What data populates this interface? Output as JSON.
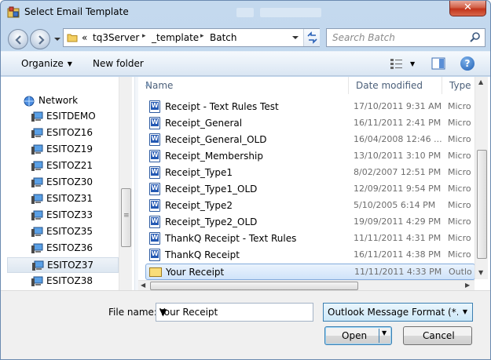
{
  "window": {
    "title": "Select Email Template",
    "close_glyph": "✕"
  },
  "nav": {
    "back_icon": "back-arrow-icon",
    "forward_icon": "forward-arrow-icon"
  },
  "address": {
    "overflow": "«",
    "crumbs": [
      "tq3Server",
      "_template",
      "Batch"
    ],
    "separator": "▸"
  },
  "search": {
    "placeholder": "Search Batch"
  },
  "toolbar": {
    "organize_label": "Organize",
    "new_folder_label": "New folder",
    "help_glyph": "?"
  },
  "navpane": {
    "network_label": "Network",
    "items": [
      "ESITDEMO",
      "ESITOZ16",
      "ESITOZ19",
      "ESITOZ21",
      "ESITOZ30",
      "ESITOZ31",
      "ESITOZ33",
      "ESITOZ35",
      "ESITOZ36",
      "ESITOZ37",
      "ESITOZ38"
    ],
    "selected": "ESITOZ37"
  },
  "filelist": {
    "columns": {
      "name": "Name",
      "date": "Date modified",
      "type": "Type"
    },
    "rows": [
      {
        "name": "Receipt - Text Rules Test",
        "date": "17/10/2011 9:31 AM",
        "type": "Micro",
        "icon": "word-doc-icon"
      },
      {
        "name": "Receipt_General",
        "date": "16/11/2011 2:41 PM",
        "type": "Micro",
        "icon": "word-doc-icon"
      },
      {
        "name": "Receipt_General_OLD",
        "date": "16/04/2008 12:46 ...",
        "type": "Micro",
        "icon": "word-doc-icon"
      },
      {
        "name": "Receipt_Membership",
        "date": "13/10/2011 3:10 PM",
        "type": "Micro",
        "icon": "word-doc-icon"
      },
      {
        "name": "Receipt_Type1",
        "date": "8/02/2007 12:51 PM",
        "type": "Micro",
        "icon": "word-doc-icon"
      },
      {
        "name": "Receipt_Type1_OLD",
        "date": "12/09/2011 9:54 PM",
        "type": "Micro",
        "icon": "word-doc-icon"
      },
      {
        "name": "Receipt_Type2",
        "date": "5/10/2005 6:14 PM",
        "type": "Micro",
        "icon": "word-doc-icon"
      },
      {
        "name": "Receipt_Type2_OLD",
        "date": "19/09/2011 4:29 PM",
        "type": "Micro",
        "icon": "word-doc-icon"
      },
      {
        "name": "ThankQ Receipt - Text Rules",
        "date": "11/11/2011 4:31 PM",
        "type": "Micro",
        "icon": "word-doc-icon"
      },
      {
        "name": "ThankQ Receipt",
        "date": "16/11/2011 4:38 PM",
        "type": "Micro",
        "icon": "word-doc-icon"
      },
      {
        "name": "Your Receipt",
        "date": "11/11/2011 4:33 PM",
        "type": "Outlo",
        "icon": "mail-message-icon"
      }
    ],
    "selected": "Your Receipt"
  },
  "bottom": {
    "file_name_label": "File name:",
    "file_name_value": "Your Receipt",
    "file_type_value": "Outlook Message Format (*.ms",
    "open_label": "Open",
    "cancel_label": "Cancel"
  },
  "colors": {
    "accent": "#3c7fb1",
    "selection": "#cfe3fa",
    "close_red": "#c2341b"
  }
}
